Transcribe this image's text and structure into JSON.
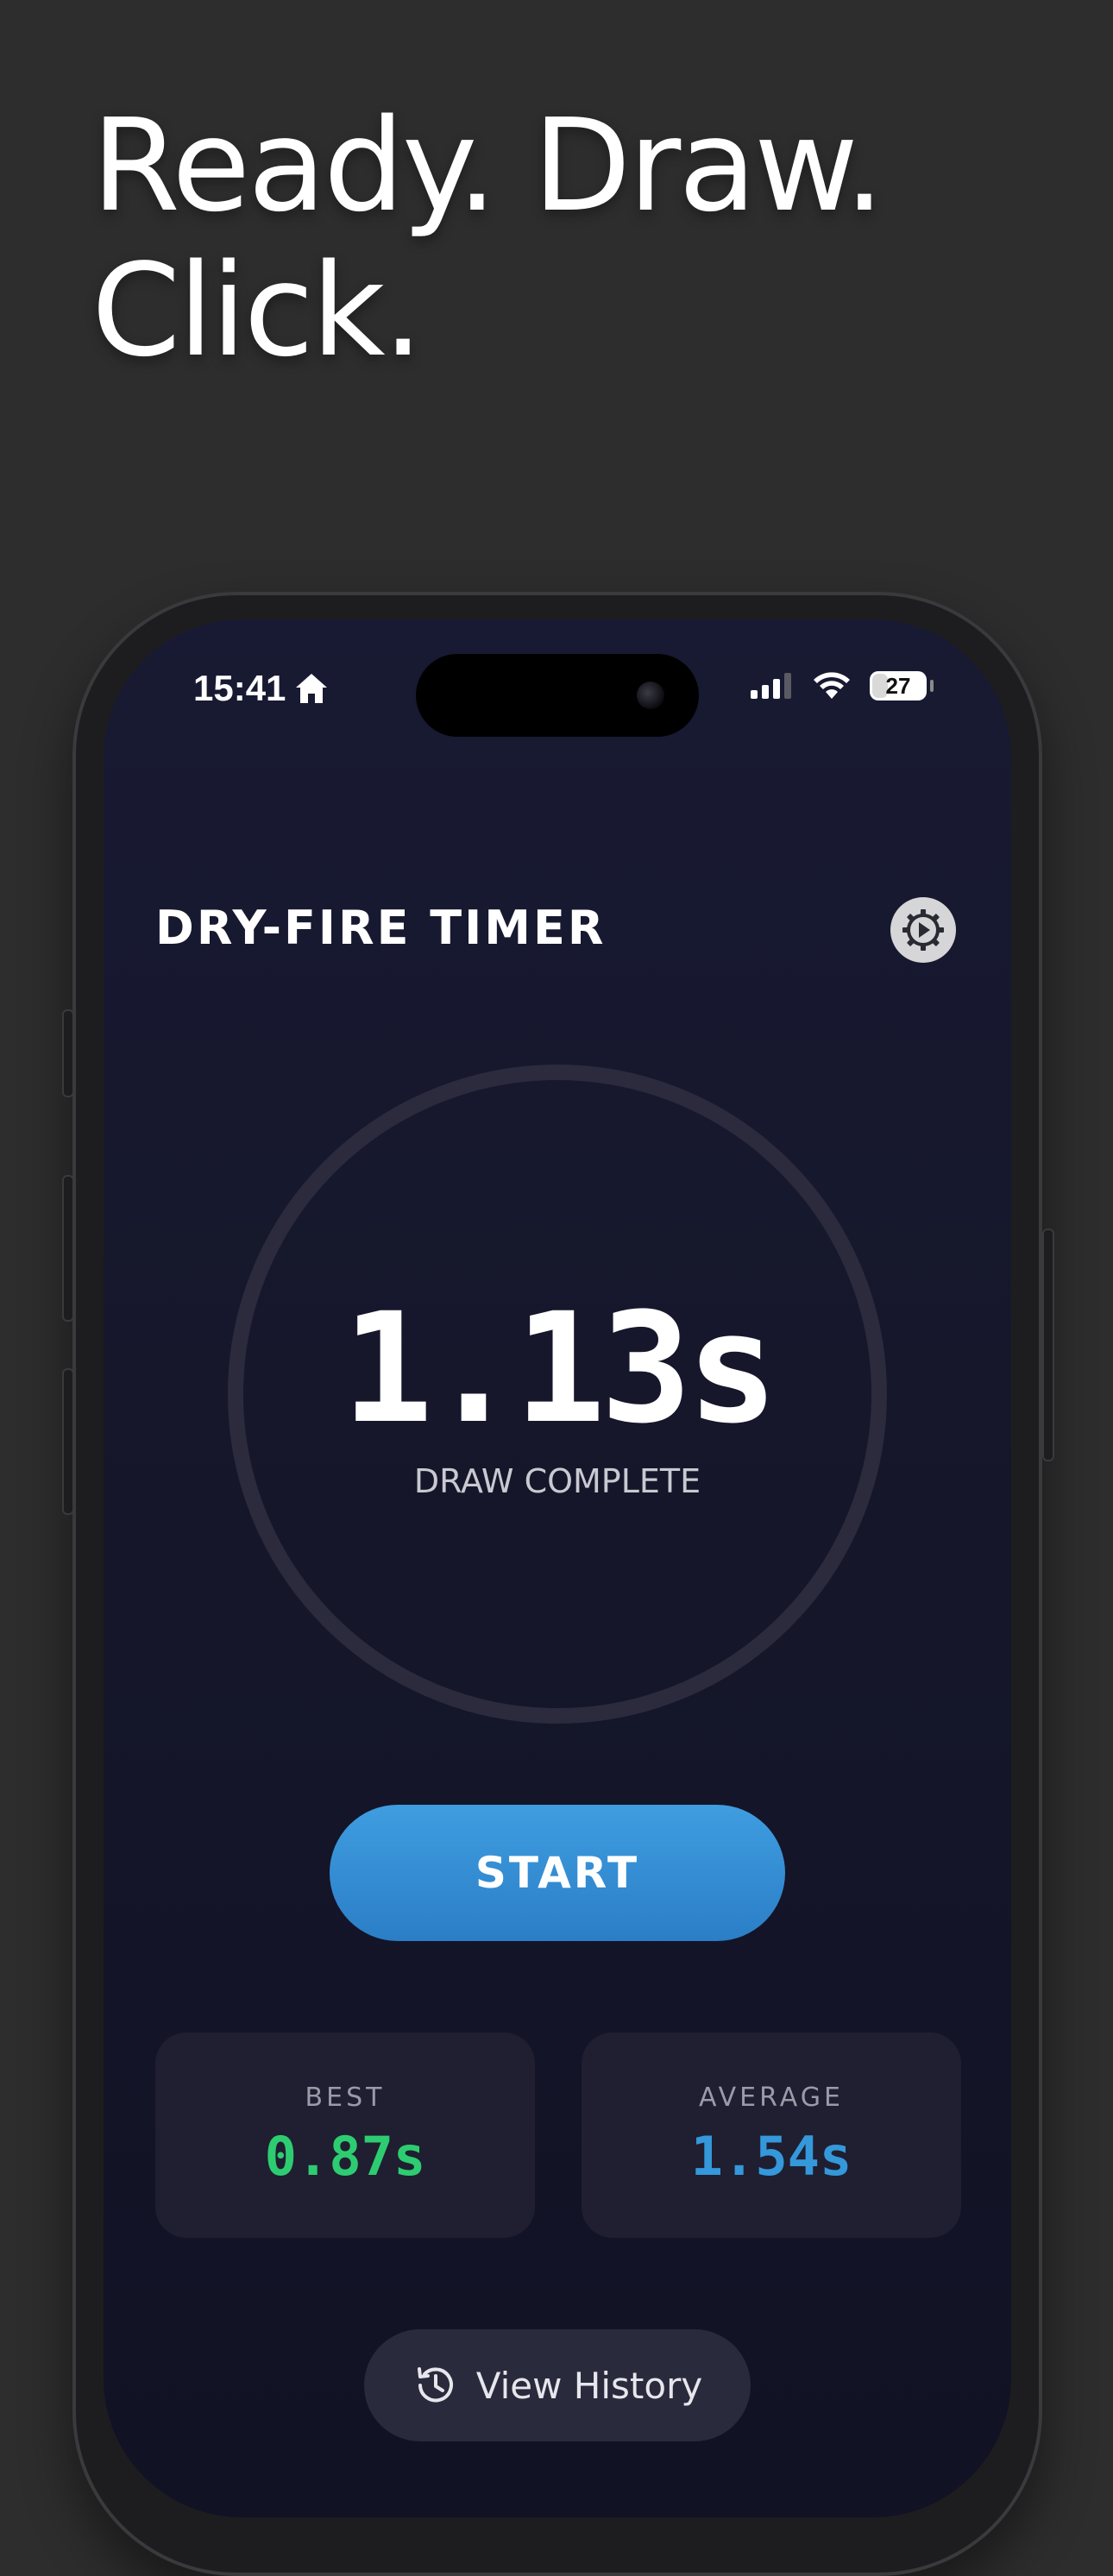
{
  "headline": {
    "line1": "Ready. Draw.",
    "line2": "Click."
  },
  "status_bar": {
    "time": "15:41",
    "battery": "27"
  },
  "app": {
    "title": "DRY-FIRE TIMER",
    "settings_icon": "gear-icon"
  },
  "timer": {
    "value": "1.13s",
    "status": "DRAW COMPLETE"
  },
  "start_button": {
    "label": "START"
  },
  "stats": {
    "best": {
      "label": "BEST",
      "value": "0.87s",
      "color": "#2ecc71"
    },
    "average": {
      "label": "AVERAGE",
      "value": "1.54s",
      "color": "#3498db"
    }
  },
  "history_button": {
    "label": "View History",
    "icon": "history-icon"
  },
  "colors": {
    "background": "#2d2d2d",
    "screen": "#16172b",
    "accent": "#3498db"
  }
}
